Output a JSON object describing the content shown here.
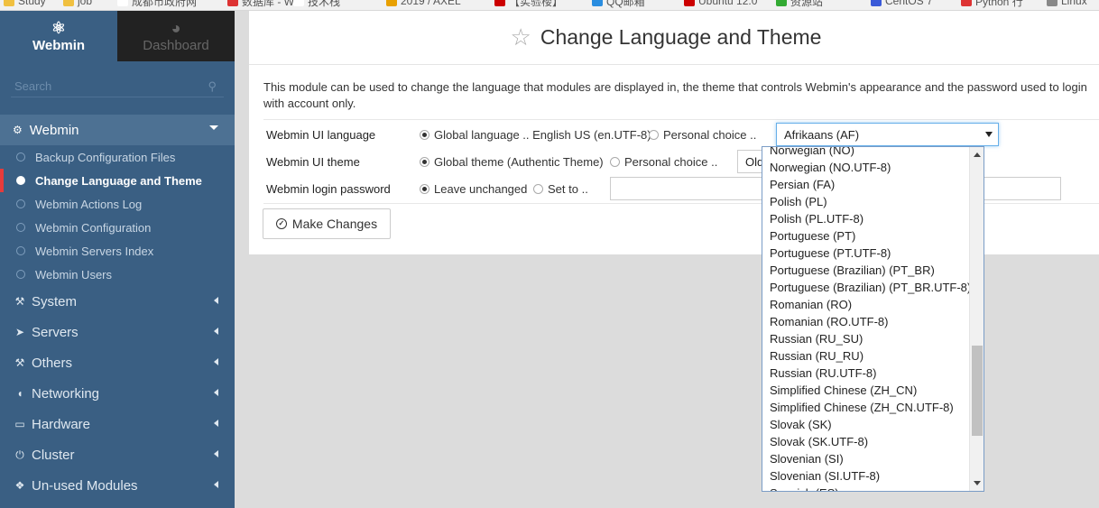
{
  "bookmarks": [
    {
      "label": "Study",
      "icon": "folder-icon",
      "color": "#f0c040"
    },
    {
      "label": "job",
      "icon": "folder-icon",
      "color": "#f0c040"
    },
    {
      "label": "成都市政府网",
      "icon": "page-icon",
      "color": "#ffffff"
    },
    {
      "label": "数据库 - W",
      "icon": "red-icon",
      "color": "#d33"
    },
    {
      "label": "技术栈",
      "icon": "page-icon",
      "color": "#ffffff"
    },
    {
      "label": "2019 / AXEL",
      "icon": "yellow-icon",
      "color": "#e8a000"
    },
    {
      "label": "【实验楼】",
      "icon": "red-icon",
      "color": "#c00"
    },
    {
      "label": "QQ邮箱",
      "icon": "blue-icon",
      "color": "#2a8de0"
    },
    {
      "label": "Ubuntu 12.0",
      "icon": "red-icon",
      "color": "#c00"
    },
    {
      "label": "资源站",
      "icon": "green-icon",
      "color": "#3a3"
    },
    {
      "label": "CentOS 7",
      "icon": "blue-icon",
      "color": "#3a5ad8"
    },
    {
      "label": "Python 行",
      "icon": "red-icon",
      "color": "#d33"
    },
    {
      "label": "Linux",
      "icon": "grey-icon",
      "color": "#888"
    }
  ],
  "sidebar": {
    "tabs": [
      {
        "label": "Webmin",
        "icon": "webmin-logo-icon"
      },
      {
        "label": "Dashboard",
        "icon": "dashboard-icon"
      }
    ],
    "search_placeholder": "Search",
    "category_webmin": "Webmin",
    "webmin_items": [
      {
        "label": "Backup Configuration Files",
        "active": false
      },
      {
        "label": "Change Language and Theme",
        "active": true
      },
      {
        "label": "Webmin Actions Log",
        "active": false
      },
      {
        "label": "Webmin Configuration",
        "active": false
      },
      {
        "label": "Webmin Servers Index",
        "active": false
      },
      {
        "label": "Webmin Users",
        "active": false
      }
    ],
    "categories": [
      {
        "label": "System",
        "icon": "wrench-icon"
      },
      {
        "label": "Servers",
        "icon": "rocket-icon"
      },
      {
        "label": "Others",
        "icon": "gavel-icon"
      },
      {
        "label": "Networking",
        "icon": "shield-icon"
      },
      {
        "label": "Hardware",
        "icon": "hdd-icon"
      },
      {
        "label": "Cluster",
        "icon": "power-icon"
      },
      {
        "label": "Un-used Modules",
        "icon": "puzzle-icon"
      }
    ]
  },
  "main": {
    "title": "Change Language and Theme",
    "description": "This module can be used to change the language that modules are displayed in, the theme that controls Webmin's appearance and the password used to login with account only.",
    "rows": {
      "language": {
        "label": "Webmin UI language",
        "opt_global": "Global language .. English US (en.UTF-8)",
        "opt_personal": "Personal choice ..",
        "selected": "Afrikaans (AF)"
      },
      "theme": {
        "label": "Webmin UI theme",
        "opt_global": "Global theme (Authentic Theme)",
        "opt_personal": "Personal choice ..",
        "selected": "Old W"
      },
      "password": {
        "label": "Webmin login password",
        "opt_leave": "Leave unchanged",
        "opt_set": "Set to .."
      }
    },
    "submit_label": "Make Changes"
  },
  "dropdown_options": [
    "Norwegian (NO)",
    "Norwegian (NO.UTF-8)",
    "Persian (FA)",
    "Polish (PL)",
    "Polish (PL.UTF-8)",
    "Portuguese (PT)",
    "Portuguese (PT.UTF-8)",
    "Portuguese (Brazilian) (PT_BR)",
    "Portuguese (Brazilian) (PT_BR.UTF-8)",
    "Romanian (RO)",
    "Romanian (RO.UTF-8)",
    "Russian (RU_SU)",
    "Russian (RU_RU)",
    "Russian (RU.UTF-8)",
    "Simplified Chinese (ZH_CN)",
    "Simplified Chinese (ZH_CN.UTF-8)",
    "Slovak (SK)",
    "Slovak (SK.UTF-8)",
    "Slovenian (SI)",
    "Slovenian (SI.UTF-8)",
    "Spanish (ES)"
  ]
}
